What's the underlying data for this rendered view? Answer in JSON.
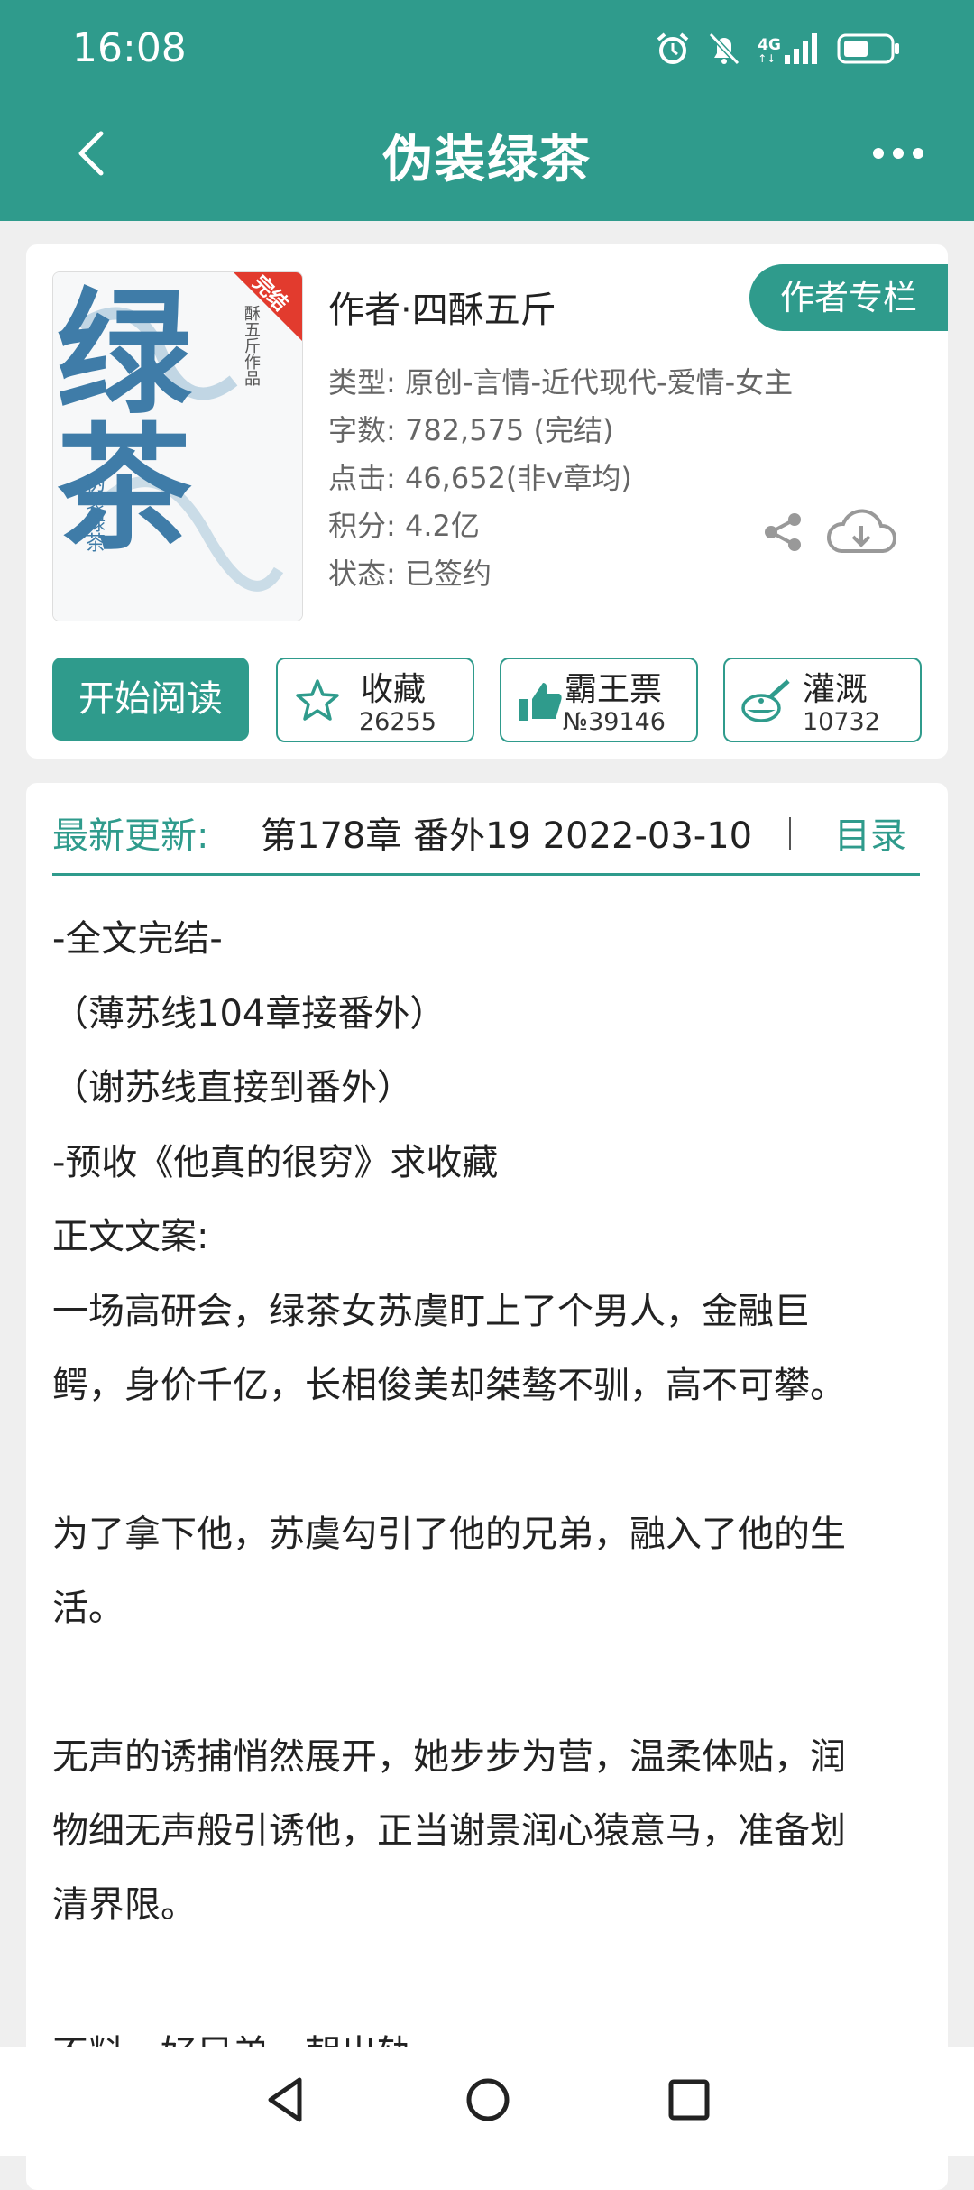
{
  "status": {
    "time": "16:08",
    "network": "4G"
  },
  "header": {
    "title": "伪装绿茶"
  },
  "book": {
    "cover_title": "绿茶",
    "cover_subtitle": "伪装绿茶",
    "cover_badge": "完结",
    "cover_author": "酥五斤作品",
    "author": "作者·四酥五斤",
    "author_column": "作者专栏",
    "type": "类型: 原创-言情-近代现代-爱情-女主",
    "words": "字数: 782,575 (完结)",
    "clicks": "点击: 46,652(非v章均)",
    "score": "积分: 4.2亿",
    "state": "状态: 已签约"
  },
  "actions": {
    "start": "开始阅读",
    "collect": {
      "label": "收藏",
      "count": "26255"
    },
    "vote": {
      "label": "霸王票",
      "count": "№39146"
    },
    "water": {
      "label": "灌溉",
      "count": "10732"
    }
  },
  "latest": {
    "label": "最新更新:",
    "text": "第178章  番外19  2022-03-10",
    "toc": "目录"
  },
  "content": [
    "-全文完结-",
    "（薄苏线104章接番外）",
    "（谢苏线直接到番外）",
    "-预收《他真的很穷》求收藏",
    "正文文案:",
    "一场高研会，绿茶女苏虞盯上了个男人，金融巨",
    "鳄，身价千亿，长相俊美却桀骜不驯，高不可攀。",
    "为了拿下他，苏虞勾引了他的兄弟，融入了他的生",
    "活。",
    "无声的诱捕悄然展开，她步步为营，温柔体贴，润",
    "物细无声般引诱他，正当谢景润心猿意马，准备划",
    "清界限。",
    "不料，好兄弟一朝出轨"
  ]
}
